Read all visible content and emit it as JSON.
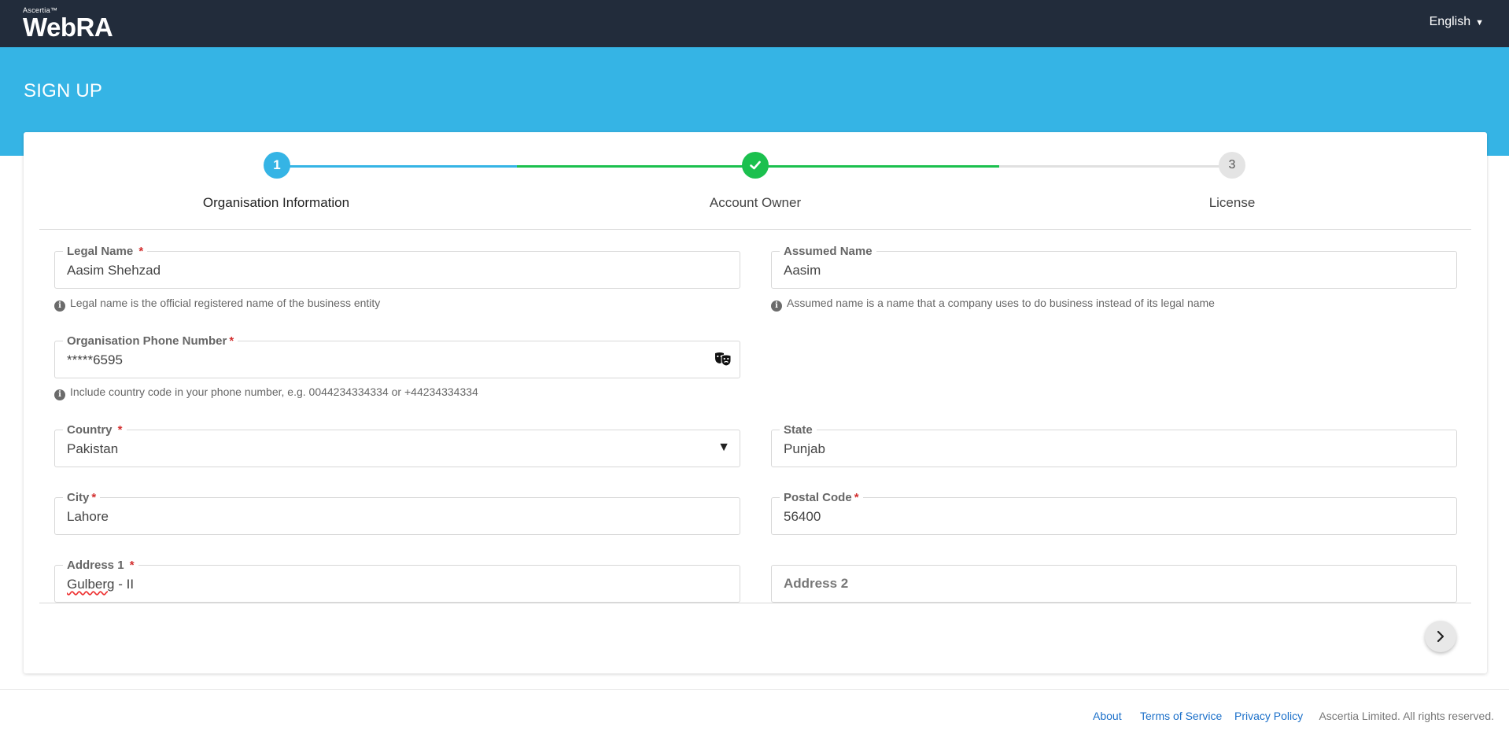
{
  "header": {
    "logo_small": "Ascertia™",
    "logo_big": "WebRA",
    "language": "English"
  },
  "banner": {
    "title": "SIGN UP"
  },
  "stepper": {
    "steps": [
      {
        "number": "1",
        "label": "Organisation Information",
        "status": "current"
      },
      {
        "number": "",
        "label": "Account Owner",
        "status": "completed"
      },
      {
        "number": "3",
        "label": "License",
        "status": "pending"
      }
    ]
  },
  "form": {
    "legal_name": {
      "label": "Legal Name",
      "value": "Aasim Shehzad",
      "hint": "Legal name is the official registered name of the business entity"
    },
    "assumed_name": {
      "label": "Assumed Name",
      "value": "Aasim",
      "hint": "Assumed name is a name that a company uses to do business instead of its legal name"
    },
    "phone": {
      "label": "Organisation Phone Number",
      "value": "*****6595",
      "hint": "Include country code in your phone number, e.g. 0044234334334 or +44234334334"
    },
    "country": {
      "label": "Country",
      "value": "Pakistan"
    },
    "state": {
      "label": "State",
      "value": "Punjab"
    },
    "city": {
      "label": "City",
      "value": "Lahore"
    },
    "postal_code": {
      "label": "Postal Code",
      "value": "56400"
    },
    "address1": {
      "label": "Address 1",
      "value_word": "Gulberg",
      "value_rest": " - II"
    },
    "address2": {
      "label": "Address 2"
    },
    "required_mark": "*"
  },
  "footer": {
    "about": "About",
    "terms": "Terms of Service",
    "privacy": "Privacy Policy",
    "copyright": "Ascertia Limited. All rights reserved."
  },
  "colors": {
    "topbar": "#222c3b",
    "banner": "#35b4e5",
    "step_active": "#35b4e5",
    "step_done": "#1bc04e",
    "step_pending": "#e0e0e0",
    "link": "#1a6fc9",
    "required": "#d32f2f"
  },
  "icons": [
    "info-icon",
    "mask-toggle-icon",
    "checkmark-icon",
    "chevron-right-icon",
    "caret-down-icon"
  ]
}
